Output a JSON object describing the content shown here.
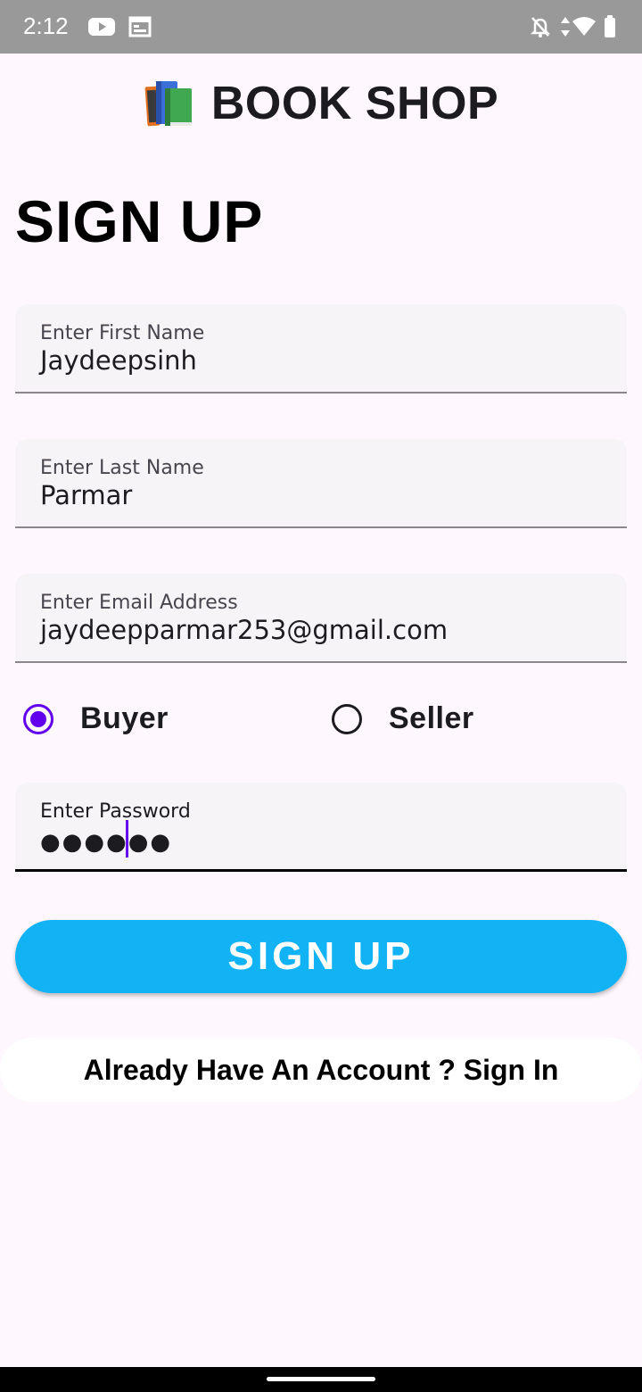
{
  "status_bar": {
    "time": "2:12",
    "icons": [
      "youtube-icon",
      "calendar-icon",
      "bell-off-icon",
      "data-arrows-icon",
      "wifi-icon",
      "battery-icon"
    ],
    "color": "#999999"
  },
  "header": {
    "logo_icon": "books-icon",
    "title": "BOOK SHOP"
  },
  "page": {
    "heading": "SIGN UP"
  },
  "form": {
    "first_name": {
      "label": "Enter First Name",
      "value": "Jaydeepsinh"
    },
    "last_name": {
      "label": "Enter Last Name",
      "value": "Parmar"
    },
    "email": {
      "label": "Enter Email Address",
      "value": "jaydeepparmar253@gmail.com"
    },
    "role": {
      "options": [
        "Buyer",
        "Seller"
      ],
      "selected": "Buyer"
    },
    "password": {
      "label": "Enter Password",
      "value": "●●●●●●"
    }
  },
  "actions": {
    "signup_label": "SIGN UP",
    "signin_link": "Already Have An Account ? Sign In"
  },
  "colors": {
    "accent": "#6200ee",
    "button": "#11b3f5",
    "background": "#fef7fd"
  }
}
